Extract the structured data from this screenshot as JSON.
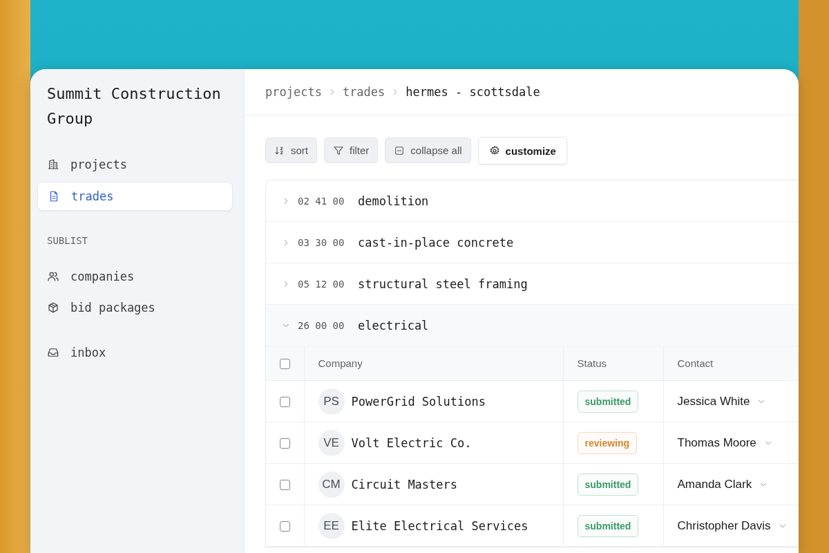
{
  "sidebar": {
    "title": "Summit Construction Group",
    "items": [
      {
        "label": "projects",
        "selected": false
      },
      {
        "label": "trades",
        "selected": true
      }
    ],
    "section_label": "SUBLIST",
    "sublist": [
      {
        "label": "companies",
        "selected": false
      },
      {
        "label": "bid packages",
        "selected": false
      }
    ],
    "footer_items": [
      {
        "label": "inbox",
        "selected": false
      }
    ]
  },
  "breadcrumb": [
    {
      "label": "projects",
      "current": false
    },
    {
      "label": "trades",
      "current": false
    },
    {
      "label": "hermes - scottsdale",
      "current": true
    }
  ],
  "toolbar": [
    {
      "label": "sort",
      "kind": "muted"
    },
    {
      "label": "filter",
      "kind": "muted"
    },
    {
      "label": "collapse all",
      "kind": "muted"
    },
    {
      "label": "customize",
      "kind": "outlined"
    }
  ],
  "trades": [
    {
      "code": "02 41 00",
      "name": "demolition",
      "expanded": false
    },
    {
      "code": "03 30 00",
      "name": "cast-in-place concrete",
      "expanded": false
    },
    {
      "code": "05 12 00",
      "name": "structural steel framing",
      "expanded": false
    },
    {
      "code": "26 00 00",
      "name": "electrical",
      "expanded": true,
      "table": {
        "all_checked": false,
        "columns": [
          "Company",
          "Status",
          "Contact"
        ],
        "rows": [
          {
            "checked": false,
            "initials": "PS",
            "company": "PowerGrid Solutions",
            "status": "submitted",
            "color": "#3d9a6a",
            "contact": "Jessica White"
          },
          {
            "checked": false,
            "initials": "VE",
            "company": "Volt Electric Co.",
            "status": "reviewing",
            "color": "#d2882e",
            "contact": "Thomas Moore"
          },
          {
            "checked": false,
            "initials": "CM",
            "company": "Circuit Masters",
            "status": "submitted",
            "color": "#3d9a6a",
            "contact": "Amanda Clark"
          },
          {
            "checked": false,
            "initials": "EE",
            "company": "Elite Electrical Services",
            "status": "submitted",
            "color": "#3d9a6a",
            "contact": "Christopher Davis"
          }
        ]
      }
    }
  ]
}
